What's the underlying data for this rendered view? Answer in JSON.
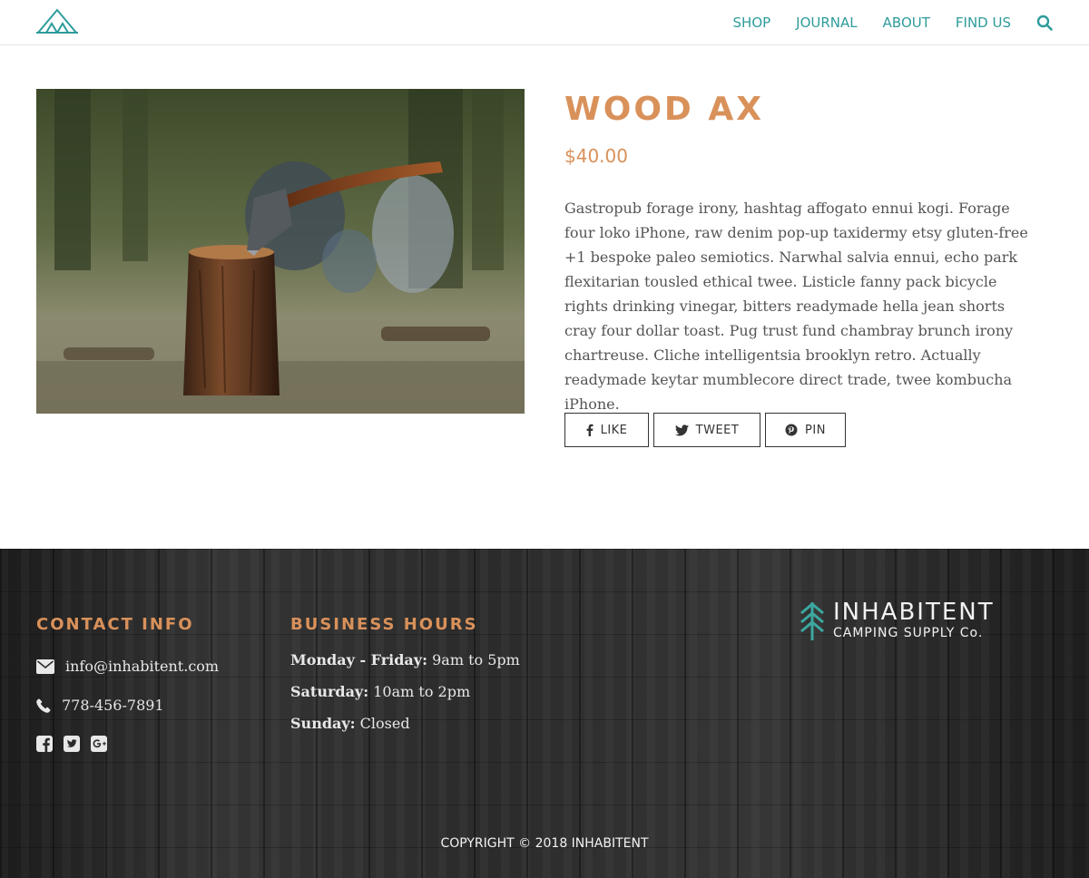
{
  "header": {
    "logo_icon": "tent-logo-icon",
    "nav": [
      {
        "label": "SHOP"
      },
      {
        "label": "JOURNAL"
      },
      {
        "label": "ABOUT"
      },
      {
        "label": "FIND US"
      }
    ],
    "search_icon": "search-icon"
  },
  "product": {
    "image_description_icon": "axe-in-stump-photo",
    "title": "WOOD AX",
    "price": "$40.00",
    "description": "Gastropub forage irony, hashtag affogato ennui kogi. Forage four loko iPhone, raw denim pop-up taxidermy etsy gluten-free +1 bespoke paleo semiotics. Narwhal salvia ennui, echo park flexitarian tousled ethical twee. Listicle fanny pack bicycle rights drinking vinegar, bitters readymade hella jean shorts cray four dollar toast. Pug trust fund chambray brunch irony chartreuse. Cliche intelligentsia brooklyn retro. Actually readymade keytar mumblecore direct trade, twee kombucha iPhone.",
    "share": {
      "like": "LIKE",
      "tweet": "TWEET",
      "pin": "PIN"
    }
  },
  "footer": {
    "contact": {
      "title": "CONTACT INFO",
      "email": "info@inhabitent.com",
      "phone": "778-456-7891",
      "socials": [
        "facebook-icon",
        "twitter-icon",
        "google-plus-icon"
      ]
    },
    "hours": {
      "title": "BUSINESS HOURS",
      "rows": [
        {
          "day": "Monday - Friday:",
          "time": "9am to 5pm"
        },
        {
          "day": "Saturday:",
          "time": "10am to 2pm"
        },
        {
          "day": "Sunday:",
          "time": "Closed"
        }
      ]
    },
    "brand": {
      "name": "INHABITENT",
      "sub": "CAMPING SUPPLY Co."
    },
    "copyright": "COPYRIGHT © 2018 INHABITENT"
  },
  "colors": {
    "accent": "#d9915a",
    "nav": "#2e9b9b",
    "brand_tree": "#3ca8a0"
  }
}
